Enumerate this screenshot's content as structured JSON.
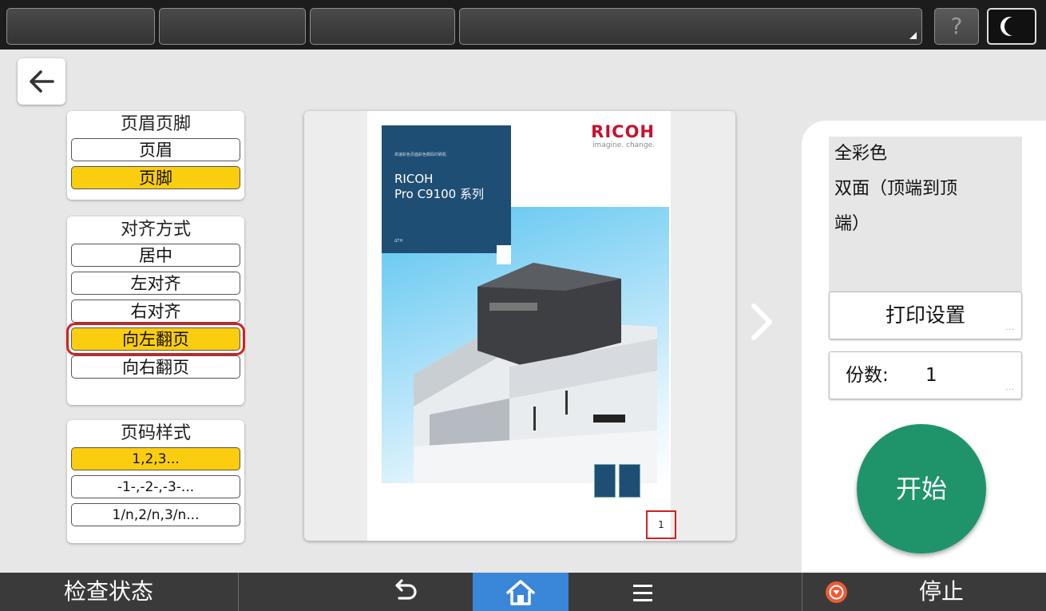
{
  "topbar": {
    "help_label": "?",
    "segments": [
      "",
      "",
      "",
      ""
    ]
  },
  "header_footer": {
    "title": "页眉页脚",
    "options": [
      {
        "label": "页眉",
        "selected": false
      },
      {
        "label": "页脚",
        "selected": true
      }
    ]
  },
  "alignment": {
    "title": "对齐方式",
    "options": [
      {
        "label": "居中",
        "selected": false
      },
      {
        "label": "左对齐",
        "selected": false
      },
      {
        "label": "右对齐",
        "selected": false
      },
      {
        "label": "向左翻页",
        "selected": true,
        "highlighted": true
      },
      {
        "label": "向右翻页",
        "selected": false
      }
    ]
  },
  "page_number_style": {
    "title": "页码样式",
    "options": [
      {
        "label": "1,2,3...",
        "selected": true
      },
      {
        "label": "-1-,-2-,-3-...",
        "selected": false
      },
      {
        "label": "1/n,2/n,3/n...",
        "selected": false
      }
    ]
  },
  "preview": {
    "logo": "RICOH",
    "logo_tagline": "imagine. change.",
    "brochure_small_text": "高速彩色页面彩色数码印刷机",
    "brochure_title_line1": "RICOH",
    "brochure_title_line2": "Pro C9100 系列",
    "brochure_footer": "ΔΤΗ",
    "page_number": "1"
  },
  "summary": {
    "color_mode": "全彩色",
    "duplex_line1": "双面（顶端到顶",
    "duplex_line2": "端）"
  },
  "print_settings_label": "打印设置",
  "copies": {
    "label": "份数:",
    "value": "1"
  },
  "more_dots": "...",
  "start_label": "开始",
  "bottom": {
    "status_label": "检查状态",
    "stop_label": "停止"
  },
  "colors": {
    "selected": "#fbcd0f",
    "highlight_border": "#d02020",
    "start_button": "#1f946b",
    "home_tab": "#3a86d8",
    "stop_icon": "#ee5a34"
  }
}
